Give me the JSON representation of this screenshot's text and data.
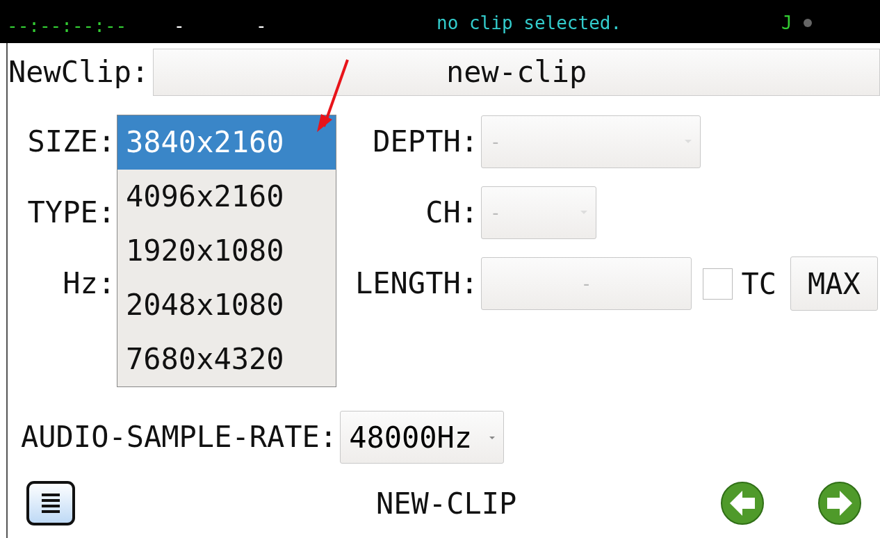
{
  "status_bar": {
    "timecode": "--:--:--:--",
    "field_1": "-",
    "field_2": "-",
    "message": "no clip selected.",
    "indicator": "J"
  },
  "new_clip": {
    "label": "NewClip:",
    "value": "new-clip"
  },
  "left_fields": [
    {
      "label": "SIZE:",
      "kind": "dropdown",
      "expanded": true,
      "options": [
        {
          "label": "3840x2160",
          "selected": true
        },
        {
          "label": "4096x2160",
          "selected": false
        },
        {
          "label": "1920x1080",
          "selected": false
        },
        {
          "label": "2048x1080",
          "selected": false
        },
        {
          "label": "7680x4320",
          "selected": false
        }
      ]
    },
    {
      "label": "TYPE:",
      "kind": "hidden"
    },
    {
      "label": "Hz:",
      "kind": "hidden"
    }
  ],
  "right_fields": [
    {
      "label": "DEPTH:",
      "kind": "dropdown",
      "value": "-",
      "disabled": true
    },
    {
      "label": "CH:",
      "kind": "dropdown",
      "value": "-",
      "disabled": true
    },
    {
      "label": "LENGTH:",
      "kind": "text",
      "value": "-",
      "disabled": true
    }
  ],
  "tc": {
    "label": "TC",
    "checked": false
  },
  "max_button": "MAX",
  "audio": {
    "label": "AUDIO-SAMPLE-RATE:",
    "value": "48000Hz"
  },
  "footer": {
    "title": "NEW-CLIP"
  }
}
